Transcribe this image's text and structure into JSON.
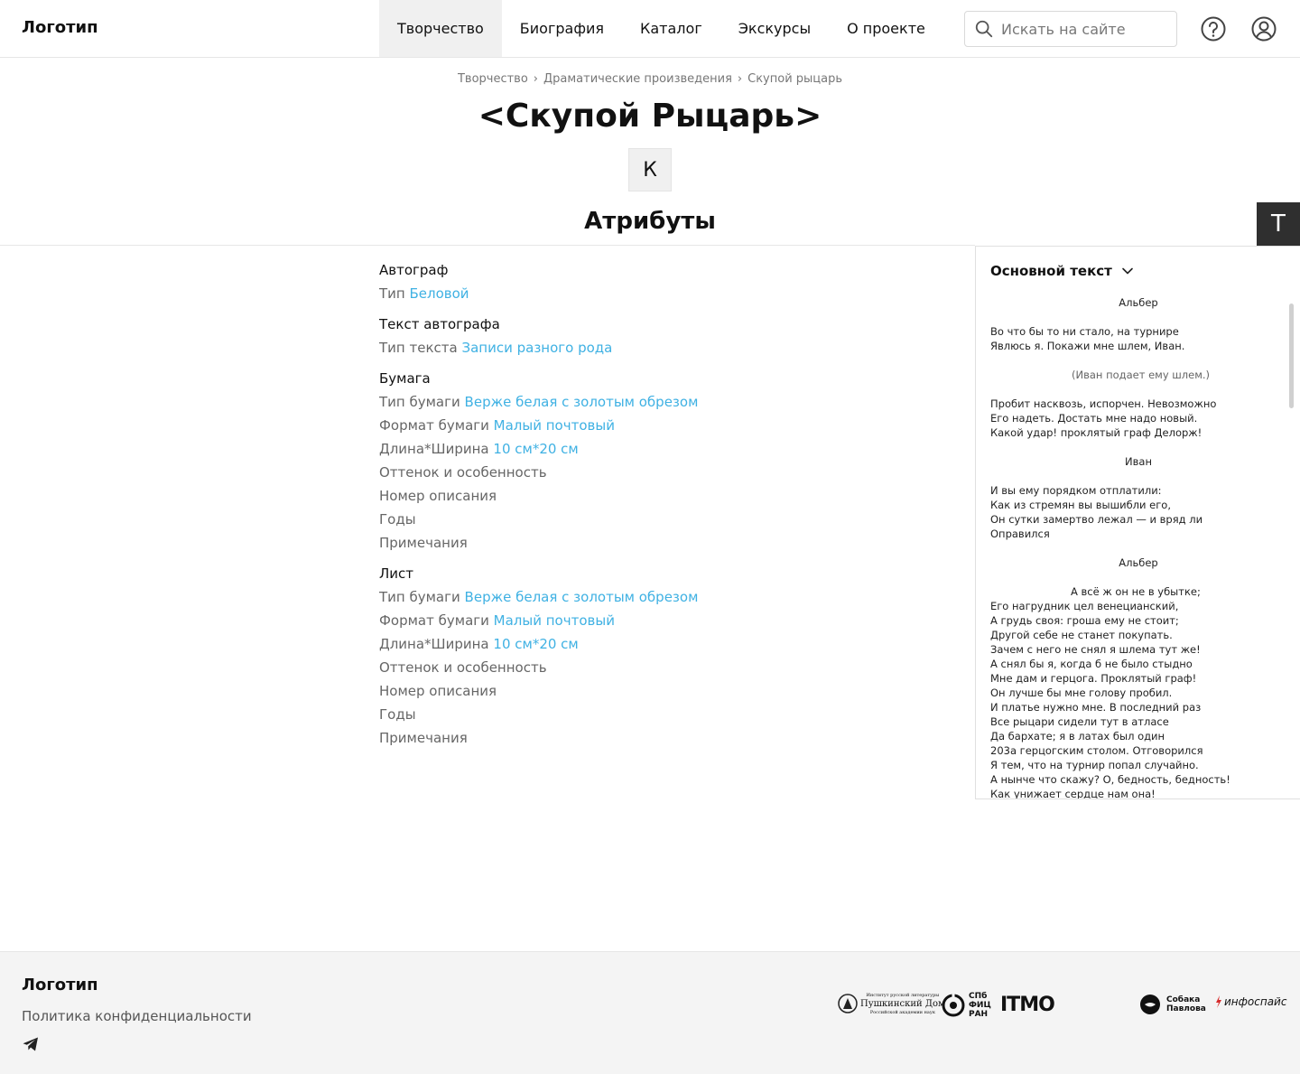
{
  "header": {
    "logo": "Логотип",
    "nav": [
      "Творчество",
      "Биография",
      "Каталог",
      "Экскурсы",
      "О проекте"
    ],
    "search_placeholder": "Искать на сайте",
    "icons": [
      "search-icon",
      "help-icon",
      "user-icon"
    ]
  },
  "breadcrumb": [
    "Творчество",
    "Драматические произведения",
    "Скупой рыцарь"
  ],
  "page": {
    "title": "<Скупой Рыцарь>",
    "letter": "К",
    "section_title": "Атрибуты",
    "text_toggle": "T"
  },
  "attributes": {
    "g1": {
      "title": "Автограф",
      "rows": [
        {
          "label": "Тип",
          "value": "Беловой"
        }
      ]
    },
    "g2": {
      "title": "Текст автографа",
      "rows": [
        {
          "label": "Тип текста",
          "value": "Записи разного рода"
        }
      ]
    },
    "g3": {
      "title": "Бумага",
      "rows": [
        {
          "label": "Тип бумаги",
          "value": "Верже белая с золотым обрезом"
        },
        {
          "label": "Формат бумаги",
          "value": "Малый почтовый"
        },
        {
          "label": "Длина*Ширина",
          "value": "10 см*20 см"
        },
        {
          "label": "Оттенок и особенность",
          "value": ""
        },
        {
          "label": "Номер описания",
          "value": ""
        },
        {
          "label": "Годы",
          "value": ""
        },
        {
          "label": "Примечания",
          "value": ""
        }
      ]
    },
    "g4": {
      "title": "Лист",
      "rows": [
        {
          "label": "Тип бумаги",
          "value": "Верже белая с золотым обрезом"
        },
        {
          "label": "Формат бумаги",
          "value": "Малый почтовый"
        },
        {
          "label": "Длина*Ширина",
          "value": "10 см*20 см"
        },
        {
          "label": "Оттенок и особенность",
          "value": ""
        },
        {
          "label": "Номер описания",
          "value": ""
        },
        {
          "label": "Годы",
          "value": ""
        },
        {
          "label": "Примечания",
          "value": ""
        }
      ]
    }
  },
  "text_panel": {
    "header": "Основной текст",
    "speaker1": "Альбер",
    "stanza1": [
      "Во что бы то ни стало, на турнире",
      "Явлюсь я. Покажи мне шлем, Иван."
    ],
    "stage1": "(Иван подает ему шлем.)",
    "stanza2": [
      "Пробит насквозь, испорчен. Невозможно",
      "Его надеть. Достать мне надо новый.",
      "Какой удар! проклятый граф Делорж!"
    ],
    "speaker2": "Иван",
    "stanza3": [
      "И вы ему порядком отплатили:",
      "Как из стремян вы вышибли его,",
      "Он сутки замертво лежал — и вряд ли",
      "Оправился"
    ],
    "speaker3": "Альбер",
    "stanza4_first": "А всё ж он не в убытке;",
    "stanza4": [
      "Его нагрудник цел венецианский,",
      "А грудь своя: гроша ему не стоит;",
      "Другой себе не станет покупать.",
      "Зачем с него не снял я шлема тут же!",
      "А снял бы я, когда б не было стыдно",
      "Мне дам и герцога. Проклятый граф!",
      "Он лучше бы мне голову пробил.",
      "И платье нужно мне. В последний раз",
      "Все рыцари сидели тут в атласе",
      "Да бархате; я в латах был один",
      "203а герцогским столом. Отговорился",
      "Я тем, что на турнир попал случайно.",
      "А нынче что скажу? О, бедность, бедность!",
      "Как унижает сердце нам она!"
    ]
  },
  "footer": {
    "logo": "Логотип",
    "privacy": "Политика конфиденциальности",
    "partners": {
      "pushkin_small_top": "Институт русской литературы",
      "pushkin_name": "Пушкинский Дом",
      "pushkin_small_bottom": "Российской академии наук",
      "spb": [
        "СПб",
        "ФИЦ",
        "РАН"
      ],
      "itmo": "ITMO",
      "sobaka": [
        "Собака",
        "Павлова"
      ],
      "infospace": "инфоспайс"
    }
  },
  "colors": {
    "link": "#3fb1e3",
    "active_nav_bg": "#f0f0f0",
    "footer_bg": "#f4f4f4",
    "t_button_bg": "#2f2f2f"
  }
}
